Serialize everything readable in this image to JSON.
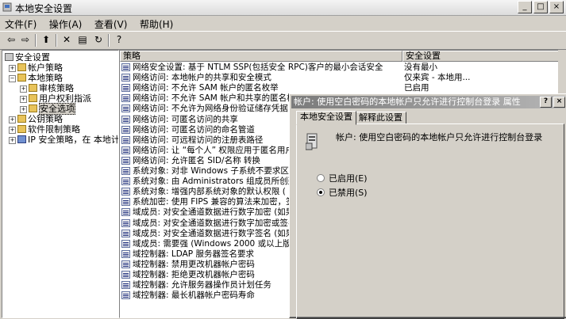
{
  "window": {
    "title": "本地安全设置",
    "controls": [
      "_",
      "□",
      "×"
    ]
  },
  "menu": [
    {
      "label": "文件(F)"
    },
    {
      "label": "操作(A)"
    },
    {
      "label": "查看(V)"
    },
    {
      "label": "帮助(H)"
    }
  ],
  "toolbar": [
    {
      "name": "back-icon",
      "glyph": "⇦"
    },
    {
      "name": "forward-icon",
      "glyph": "⇨"
    },
    {
      "name": "up-folder-icon",
      "glyph": "⬆"
    },
    {
      "name": "delete-icon",
      "glyph": "✕"
    },
    {
      "name": "properties-icon",
      "glyph": "▤"
    },
    {
      "name": "refresh-icon",
      "glyph": "↻"
    },
    {
      "name": "help-icon",
      "glyph": "?"
    }
  ],
  "tree": [
    {
      "label": "安全设置",
      "expander": "",
      "level": 0
    },
    {
      "label": "帐户策略",
      "expander": "+",
      "level": 1
    },
    {
      "label": "本地策略",
      "expander": "−",
      "level": 1
    },
    {
      "label": "审核策略",
      "expander": "+",
      "level": 2
    },
    {
      "label": "用户权利指派",
      "expander": "+",
      "level": 2
    },
    {
      "label": "安全选项",
      "expander": "+",
      "level": 2,
      "selected": true
    },
    {
      "label": "公钥策略",
      "expander": "+",
      "level": 1
    },
    {
      "label": "软件限制策略",
      "expander": "+",
      "level": 1
    },
    {
      "label": "IP 安全策略，在 本地计",
      "expander": "+",
      "level": 1
    }
  ],
  "list": {
    "headers": {
      "policy": "策略",
      "setting": "安全设置"
    },
    "rows": [
      {
        "policy": "网络安全设置: 基于 NTLM SSP(包括安全 RPC)客户的最小会话安全",
        "setting": "没有最小"
      },
      {
        "policy": "网络访问: 本地帐户的共享和安全模式",
        "setting": "仅来宾 - 本地用..."
      },
      {
        "policy": "网络访问: 不允许 SAM 帐户的匿名枚举",
        "setting": "已启用"
      },
      {
        "policy": "网络访问: 不允许 SAM 帐户和共享的匿名枚",
        "setting": ""
      },
      {
        "policy": "网络访问: 不允许为网络身份验证储存凭据",
        "setting": ""
      },
      {
        "policy": "网络访问: 可匿名访问的共享",
        "setting": ""
      },
      {
        "policy": "网络访问: 可匿名访问的命名管道",
        "setting": ""
      },
      {
        "policy": "网络访问: 可远程访问的注册表路径",
        "setting": ""
      },
      {
        "policy": "网络访问: 让 “每个人” 权限应用于匿名用户",
        "setting": ""
      },
      {
        "policy": "网络访问: 允许匿名 SID/名称 转换",
        "setting": ""
      },
      {
        "policy": "系统对象: 对非 Windows 子系统不要求区分",
        "setting": ""
      },
      {
        "policy": "系统对象: 由 Administrators 组成员所创建",
        "setting": ""
      },
      {
        "policy": "系统对象: 增强内部系统对象的默认权限 (",
        "setting": ""
      },
      {
        "policy": "系统加密: 使用 FIPS 兼容的算法来加密，签",
        "setting": ""
      },
      {
        "policy": "域成员: 对安全通道数据进行数字加密 (如果",
        "setting": ""
      },
      {
        "policy": "域成员: 对安全通道数据进行数字加密或签名",
        "setting": ""
      },
      {
        "policy": "域成员: 对安全通道数据进行数字签名 (如果",
        "setting": ""
      },
      {
        "policy": "域成员: 需要强 (Windows 2000 或以上版本",
        "setting": ""
      },
      {
        "policy": "域控制器: LDAP 服务器签名要求",
        "setting": ""
      },
      {
        "policy": "域控制器: 禁用更改机器帐户密码",
        "setting": ""
      },
      {
        "policy": "域控制器: 拒绝更改机器帐户密码",
        "setting": ""
      },
      {
        "policy": "域控制器: 允许服务器操作员计划任务",
        "setting": ""
      },
      {
        "policy": "域控制器: 最长机器帐户密码寿命",
        "setting": ""
      }
    ]
  },
  "dialog": {
    "title": "帐户: 使用空白密码的本地帐户只允许进行控制台登录 属性",
    "help_label": "?",
    "close_label": "×",
    "tabs": [
      {
        "label": "本地安全设置",
        "active": true
      },
      {
        "label": "解释此设置",
        "active": false
      }
    ],
    "policy_text": "帐户: 使用空白密码的本地帐户只允许进行控制台登录",
    "options": [
      {
        "label": "已启用(E)",
        "checked": false
      },
      {
        "label": "已禁用(S)",
        "checked": true
      }
    ]
  }
}
